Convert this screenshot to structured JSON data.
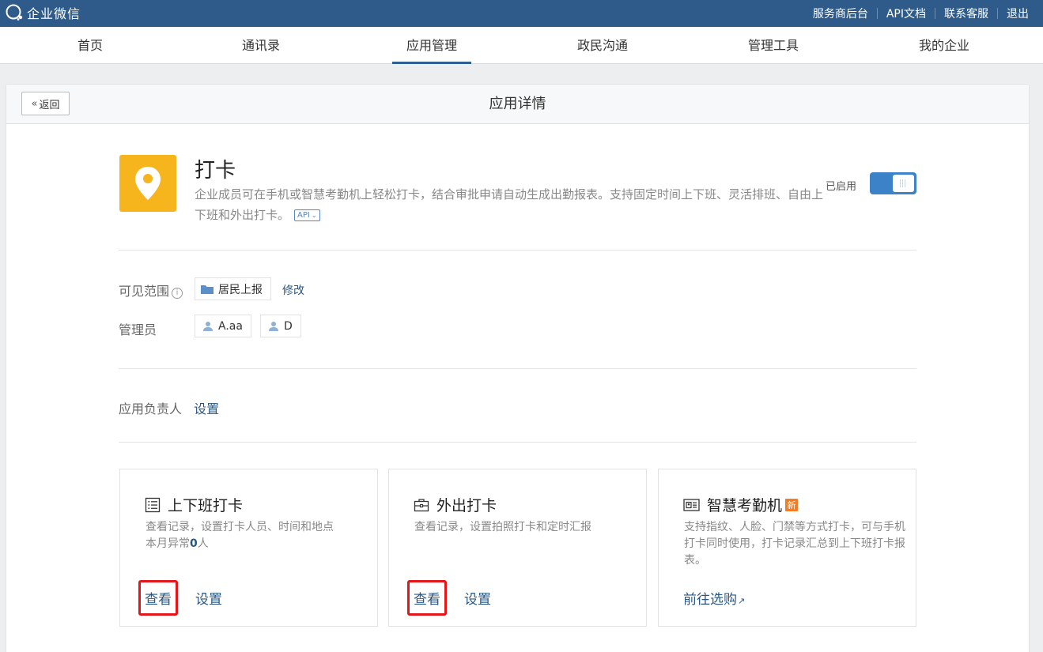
{
  "topbar": {
    "logo_text": "企业微信",
    "links": [
      "服务商后台",
      "API文档",
      "联系客服",
      "退出"
    ]
  },
  "nav": {
    "items": [
      "首页",
      "通讯录",
      "应用管理",
      "政民沟通",
      "管理工具",
      "我的企业"
    ],
    "active": "应用管理"
  },
  "panel": {
    "back_label": "返回",
    "title": "应用详情"
  },
  "app": {
    "name": "打卡",
    "description": "企业成员可在手机或智慧考勤机上轻松打卡，结合审批申请自动生成出勤报表。支持固定时间上下班、灵活排班、自由上下班和外出打卡。",
    "api_tag": "API",
    "status_label": "已启用",
    "enabled": true,
    "icon": "location-pin-icon"
  },
  "visibility": {
    "label": "可见范围",
    "dept": "居民上报",
    "modify": "修改"
  },
  "admins": {
    "label": "管理员",
    "items": [
      "A.aa",
      "D"
    ]
  },
  "owner": {
    "label": "应用负责人",
    "set": "设置"
  },
  "cards": [
    {
      "title": "上下班打卡",
      "desc_line1": "查看记录，设置打卡人员、时间和地点",
      "desc_prefix": "本月异常",
      "desc_count": "0",
      "desc_suffix": "人",
      "view": "查看",
      "set": "设置",
      "icon": "list-icon"
    },
    {
      "title": "外出打卡",
      "desc": "查看记录，设置拍照打卡和定时汇报",
      "view": "查看",
      "set": "设置",
      "icon": "briefcase-icon"
    },
    {
      "title": "智慧考勤机",
      "badge": "新",
      "desc": "支持指纹、人脸、门禁等方式打卡，可与手机打卡同时使用，打卡记录汇总到上下班打卡报表。",
      "link": "前往选购",
      "icon": "attendance-device-icon"
    }
  ]
}
